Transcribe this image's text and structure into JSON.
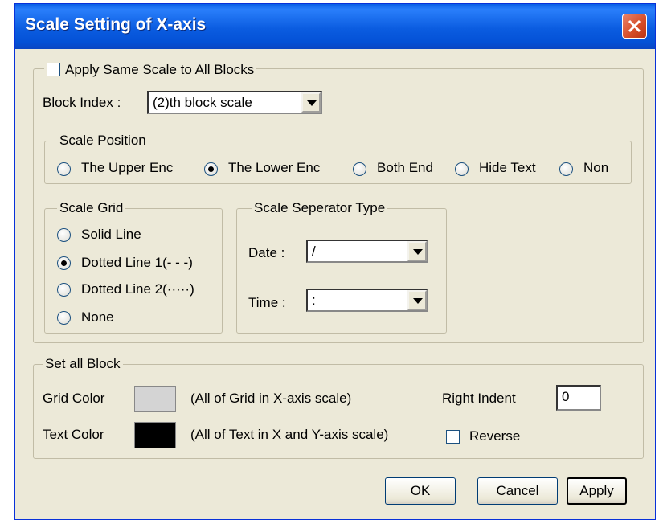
{
  "window": {
    "title": "Scale Setting of X-axis"
  },
  "apply_same": {
    "label": "Apply Same Scale to All Blocks",
    "checked": false
  },
  "block_index": {
    "label": "Block Index :",
    "value": "(2)th block scale"
  },
  "scale_position": {
    "legend": "Scale Position",
    "options": [
      "The Upper Enc",
      "The Lower Enc",
      "Both End",
      "Hide Text",
      "Non"
    ],
    "selected": "The Lower Enc"
  },
  "scale_grid": {
    "legend": "Scale Grid",
    "options": [
      "Solid Line",
      "Dotted Line 1(- - -)",
      "Dotted Line 2(·····)",
      "None"
    ],
    "selected": "Dotted Line 1(- - -)"
  },
  "separator": {
    "legend": "Scale Seperator Type",
    "date_label": "Date :",
    "date_value": "/",
    "time_label": "Time :",
    "time_value": ":"
  },
  "set_all": {
    "legend": "Set all Block",
    "grid_color_label": "Grid Color",
    "grid_color": "#d4d4d4",
    "grid_desc": "(All of Grid in X-axis scale)",
    "text_color_label": "Text Color",
    "text_color": "#000000",
    "text_desc": "(All of Text in X and Y-axis scale)",
    "right_indent_label": "Right Indent",
    "right_indent_value": "0",
    "reverse_label": "Reverse",
    "reverse_checked": false
  },
  "buttons": {
    "ok": "OK",
    "cancel": "Cancel",
    "apply": "Apply"
  }
}
